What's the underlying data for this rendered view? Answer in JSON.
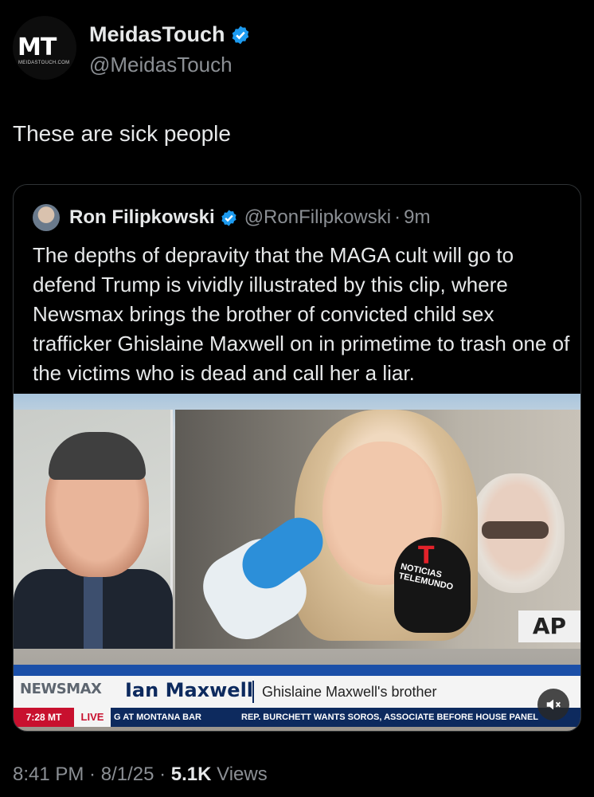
{
  "author": {
    "avatar_text": "MT",
    "avatar_subtext": "MEIDASTOUCH.COM",
    "name": "MeidasTouch",
    "handle": "@MeidasTouch"
  },
  "tweet_text": "These are sick people",
  "quote": {
    "name": "Ron Filipkowski",
    "handle": "@RonFilipkowski",
    "separator": "·",
    "time": "9m",
    "text": "The depths of depravity that the MAGA cult will go to defend Trump is vividly illustrated by this clip, where Newsmax brings the brother of convicted child sex trafficker Ghislaine Maxwell on in primetime to trash one of the victims who is dead and call her a liar.",
    "video": {
      "network": "NEWSMAX",
      "lower_third_name": "Ian Maxwell",
      "lower_third_sub": "Ghislaine Maxwell's brother",
      "time": "7:28 MT",
      "live": "LIVE",
      "ticker_1": "G AT MONTANA BAR",
      "ticker_2": "REP. BURCHETT WANTS SOROS, ASSOCIATE BEFORE HOUSE PANEL",
      "mic_logo": "T",
      "mic_text": "NOTICIAS TELEMUNDO",
      "ap_sign": "AP"
    }
  },
  "footer": {
    "time": "8:41 PM",
    "sep1": " · ",
    "date": "8/1/25",
    "sep2": " · ",
    "views_count": "5.1K",
    "views_label": " Views"
  },
  "colors": {
    "background": "#000000",
    "text": "#e7e9ea",
    "muted": "#8b8f94",
    "verified": "#1d9bf0",
    "newsmax_blue": "#0d2a5e",
    "newsmax_red": "#c8102e"
  }
}
